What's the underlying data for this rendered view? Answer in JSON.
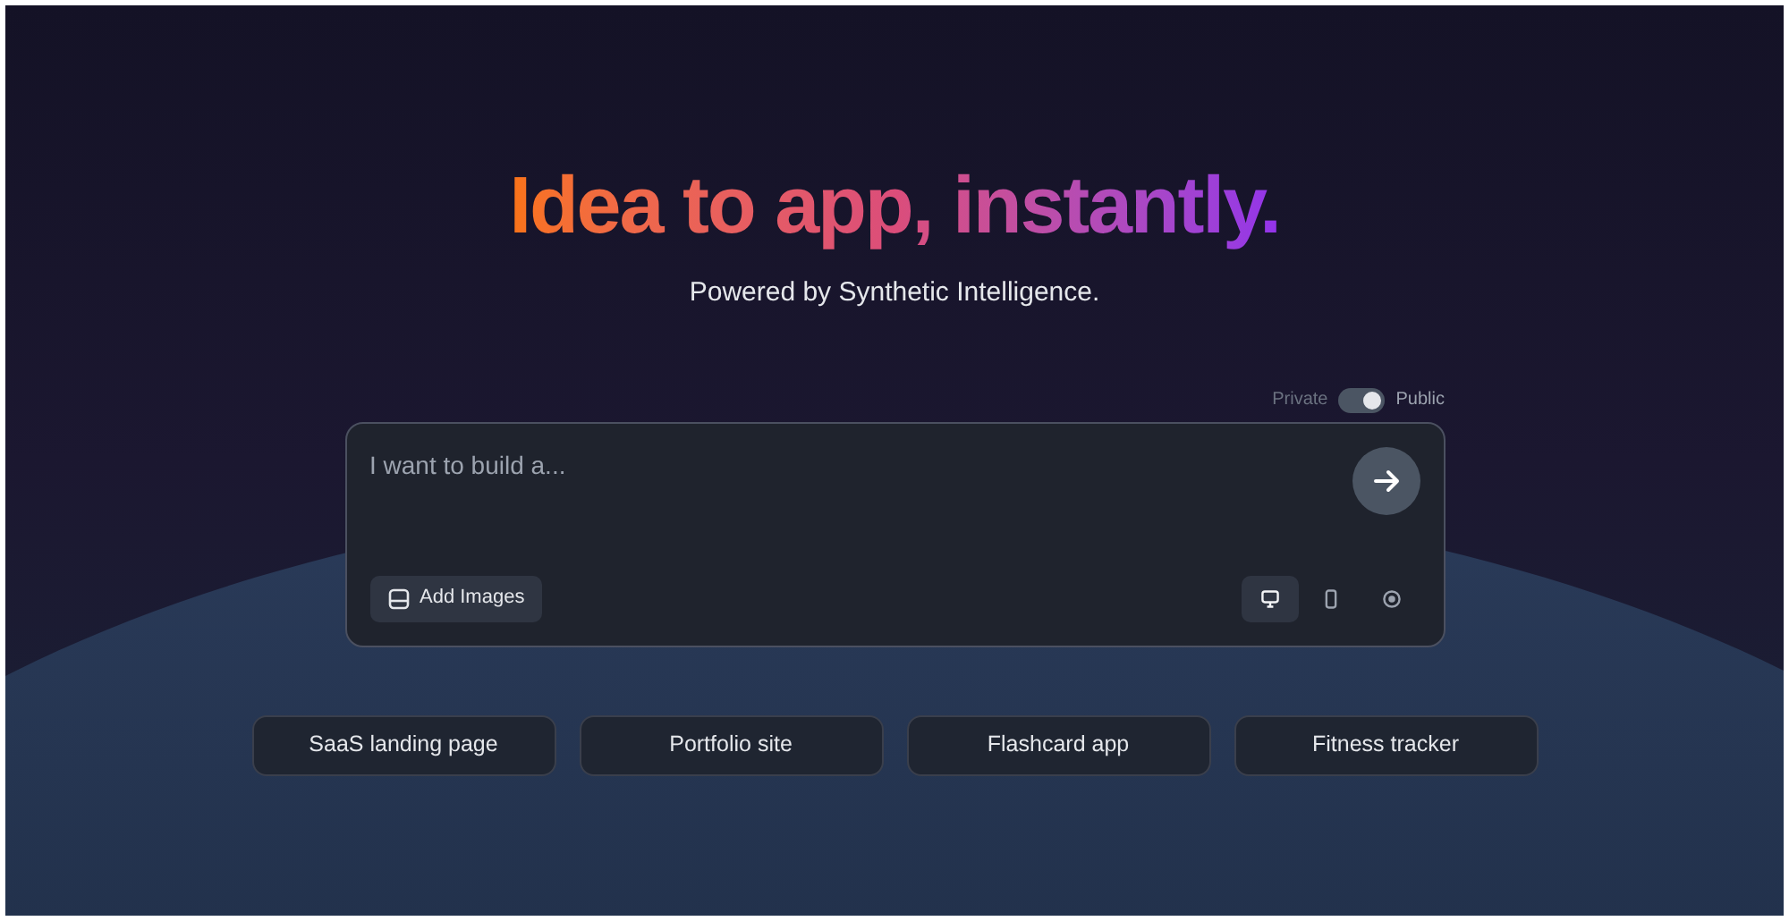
{
  "hero": {
    "title": "Idea to app, instantly.",
    "subtitle": "Powered by Synthetic Intelligence."
  },
  "visibility_toggle": {
    "left_label": "Private",
    "right_label": "Public",
    "on": true
  },
  "prompt": {
    "placeholder": "I want to build a...",
    "add_images_label": "Add Images",
    "devices": [
      {
        "kind": "desktop",
        "selected": true
      },
      {
        "kind": "mobile",
        "selected": false
      },
      {
        "kind": "other",
        "selected": false
      }
    ]
  },
  "suggestions": [
    "SaaS landing page",
    "Portfolio site",
    "Flashcard app",
    "Fitness tracker"
  ]
}
